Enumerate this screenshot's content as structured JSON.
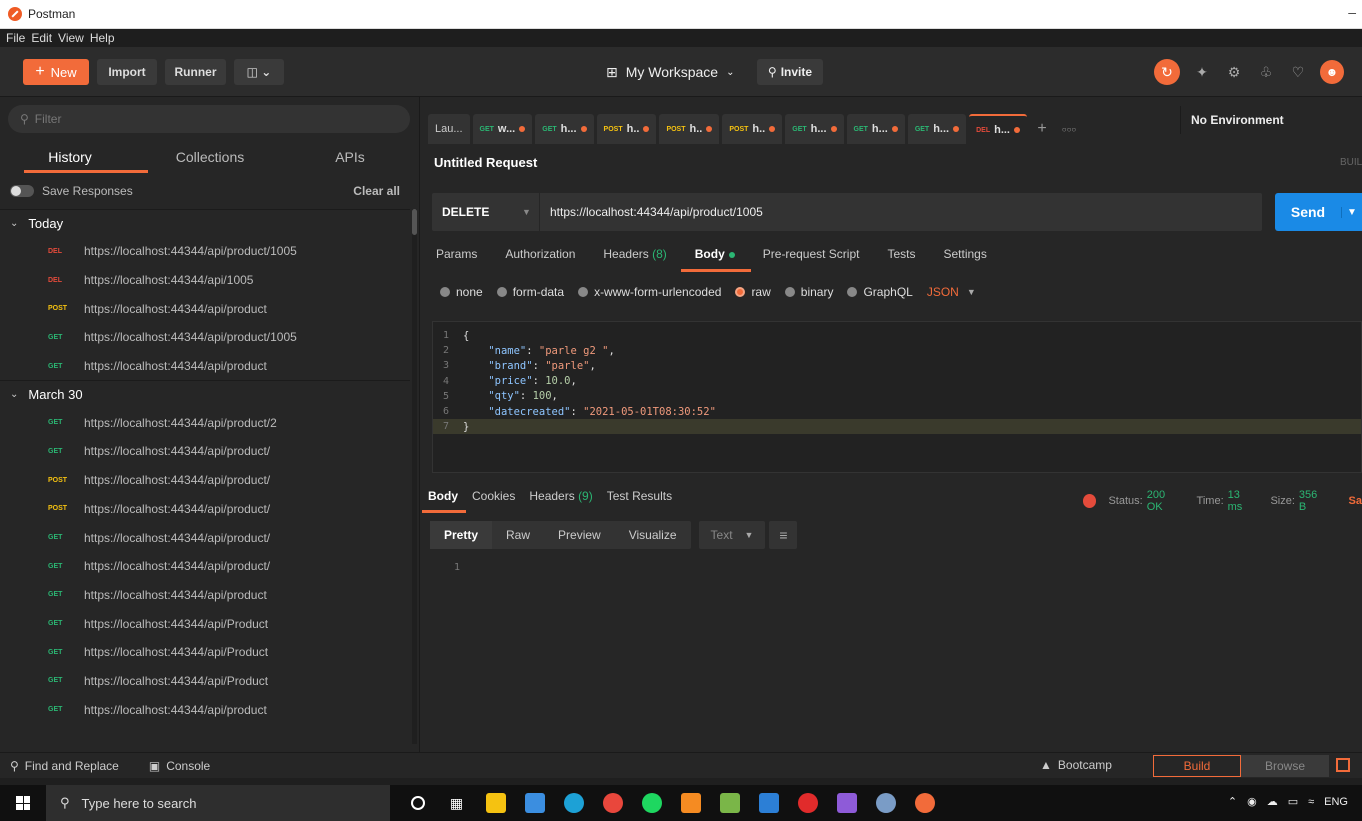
{
  "window": {
    "title": "Postman"
  },
  "menu": [
    "File",
    "Edit",
    "View",
    "Help"
  ],
  "header": {
    "new_label": "New",
    "import_label": "Import",
    "runner_label": "Runner",
    "workspace_label": "My Workspace",
    "invite_label": "Invite"
  },
  "sidebar": {
    "filter_placeholder": "Filter",
    "tabs": [
      "History",
      "Collections",
      "APIs"
    ],
    "save_responses": "Save Responses",
    "clear_all": "Clear all",
    "groups": [
      {
        "label": "Today",
        "items": [
          {
            "method": "DEL",
            "url": "https://localhost:44344/api/product/1005"
          },
          {
            "method": "DEL",
            "url": "https://localhost:44344/api/1005"
          },
          {
            "method": "POST",
            "url": "https://localhost:44344/api/product"
          },
          {
            "method": "GET",
            "url": "https://localhost:44344/api/product/1005"
          },
          {
            "method": "GET",
            "url": "https://localhost:44344/api/product"
          }
        ]
      },
      {
        "label": "March 30",
        "items": [
          {
            "method": "GET",
            "url": "https://localhost:44344/api/product/2"
          },
          {
            "method": "GET",
            "url": "https://localhost:44344/api/product/"
          },
          {
            "method": "POST",
            "url": "https://localhost:44344/api/product/"
          },
          {
            "method": "POST",
            "url": "https://localhost:44344/api/product/"
          },
          {
            "method": "GET",
            "url": "https://localhost:44344/api/product/"
          },
          {
            "method": "GET",
            "url": "https://localhost:44344/api/product/"
          },
          {
            "method": "GET",
            "url": "https://localhost:44344/api/product"
          },
          {
            "method": "GET",
            "url": "https://localhost:44344/api/Product"
          },
          {
            "method": "GET",
            "url": "https://localhost:44344/api/Product"
          },
          {
            "method": "GET",
            "url": "https://localhost:44344/api/Product"
          },
          {
            "method": "GET",
            "url": "https://localhost:44344/api/product"
          }
        ]
      }
    ]
  },
  "request_tabs": [
    {
      "method": "",
      "label": "Lau...",
      "dot": false,
      "active": false
    },
    {
      "method": "GET",
      "label": "w...",
      "dot": true,
      "active": false
    },
    {
      "method": "GET",
      "label": "h...",
      "dot": true,
      "active": false
    },
    {
      "method": "POST",
      "label": "h..",
      "dot": true,
      "active": false
    },
    {
      "method": "POST",
      "label": "h..",
      "dot": true,
      "active": false
    },
    {
      "method": "POST",
      "label": "h..",
      "dot": true,
      "active": false
    },
    {
      "method": "GET",
      "label": "h...",
      "dot": true,
      "active": false
    },
    {
      "method": "GET",
      "label": "h...",
      "dot": true,
      "active": false
    },
    {
      "method": "GET",
      "label": "h...",
      "dot": true,
      "active": false
    },
    {
      "method": "DEL",
      "label": "h...",
      "dot": true,
      "active": true
    }
  ],
  "environment": "No Environment",
  "request": {
    "title": "Untitled Request",
    "build_label": "BUIL",
    "method": "DELETE",
    "url": "https://localhost:44344/api/product/1005",
    "send_label": "Send",
    "tabs": {
      "params": "Params",
      "authorization": "Authorization",
      "headers": "Headers",
      "headers_count": "(8)",
      "body": "Body",
      "prerequest": "Pre-request Script",
      "tests": "Tests",
      "settings": "Settings"
    },
    "body_types": [
      "none",
      "form-data",
      "x-www-form-urlencoded",
      "raw",
      "binary",
      "GraphQL"
    ],
    "selected_body_type": "raw",
    "format": "JSON",
    "code_lines": [
      "{",
      "    \"name\": \"parle g2 \",",
      "    \"brand\": \"parle\",",
      "    \"price\": 10.0,",
      "    \"qty\": 100,",
      "    \"datecreated\": \"2021-05-01T08:30:52\"",
      "}"
    ]
  },
  "response": {
    "tabs": {
      "body": "Body",
      "cookies": "Cookies",
      "headers": "Headers",
      "headers_count": "(9)",
      "test_results": "Test Results"
    },
    "status_label": "Status:",
    "status_value": "200 OK",
    "time_label": "Time:",
    "time_value": "13 ms",
    "size_label": "Size:",
    "size_value": "356 B",
    "save_label": "Sa",
    "views": [
      "Pretty",
      "Raw",
      "Preview",
      "Visualize"
    ],
    "active_view": "Pretty",
    "format": "Text",
    "line_number": "1"
  },
  "footer": {
    "find_replace": "Find and Replace",
    "console": "Console",
    "bootcamp": "Bootcamp",
    "build": "Build",
    "browse": "Browse"
  },
  "taskbar": {
    "search_placeholder": "Type here to search",
    "lang": "ENG"
  },
  "colors": {
    "accent": "#f26b3a",
    "send": "#1a8ae6",
    "get": "#2bb673",
    "post": "#f5c211",
    "del": "#e44b3b"
  }
}
